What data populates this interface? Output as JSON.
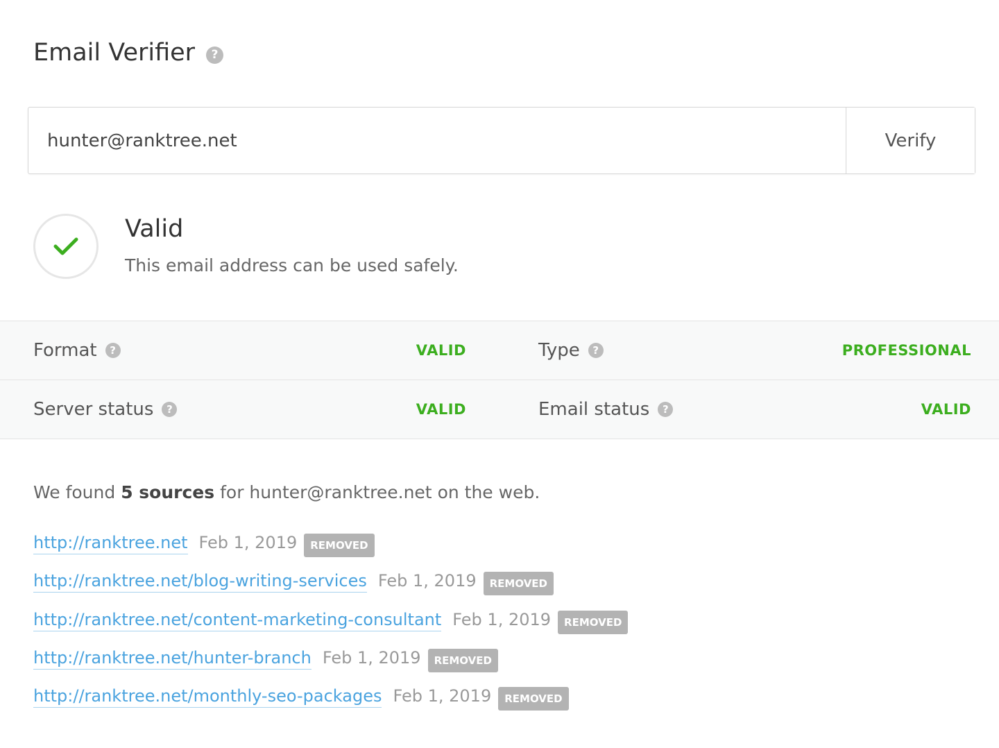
{
  "header": {
    "title": "Email Verifier",
    "help_icon": "question-circle-icon"
  },
  "form": {
    "email_value": "hunter@ranktree.net",
    "verify_label": "Verify"
  },
  "result": {
    "icon": "check-icon",
    "status": "Valid",
    "description": "This email address can be used safely.",
    "color": "#3cae1f"
  },
  "details": [
    {
      "label": "Format",
      "value": "VALID"
    },
    {
      "label": "Type",
      "value": "PROFESSIONAL"
    },
    {
      "label": "Server status",
      "value": "VALID"
    },
    {
      "label": "Email status",
      "value": "VALID"
    }
  ],
  "sources": {
    "intro": "We found",
    "count_text": "5 sources",
    "for_text": "for",
    "email": "hunter@ranktree.net",
    "suffix": "on the web.",
    "items": [
      {
        "url": "http://ranktree.net",
        "date": "Feb 1, 2019",
        "badge": "REMOVED"
      },
      {
        "url": "http://ranktree.net/blog-writing-services",
        "date": "Feb 1, 2019",
        "badge": "REMOVED"
      },
      {
        "url": "http://ranktree.net/content-marketing-consultant",
        "date": "Feb 1, 2019",
        "badge": "REMOVED"
      },
      {
        "url": "http://ranktree.net/hunter-branch",
        "date": "Feb 1, 2019",
        "badge": "REMOVED"
      },
      {
        "url": "http://ranktree.net/monthly-seo-packages",
        "date": "Feb 1, 2019",
        "badge": "REMOVED"
      }
    ]
  },
  "colors": {
    "valid_green": "#3cae1f",
    "link_blue": "#4aa3df",
    "badge_gray": "#b3b3b3"
  }
}
